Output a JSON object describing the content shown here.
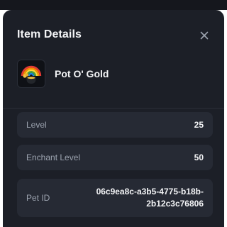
{
  "modal": {
    "title": "Item Details",
    "close_icon": "close-icon"
  },
  "item": {
    "name": "Pot O' Gold",
    "icon": "pot-of-gold-rainbow-icon"
  },
  "fields": [
    {
      "label": "Level",
      "value": "25"
    },
    {
      "label": "Enchant Level",
      "value": "50"
    },
    {
      "label": "Pet ID",
      "value": "06c9ea8c-a3b5-4775-b18b-2b12c3c76806"
    }
  ],
  "colors": {
    "modal_bg": "#1c1f27",
    "field_bg": "#262a34",
    "label": "#9ca3af",
    "value": "#f3f4f6"
  }
}
